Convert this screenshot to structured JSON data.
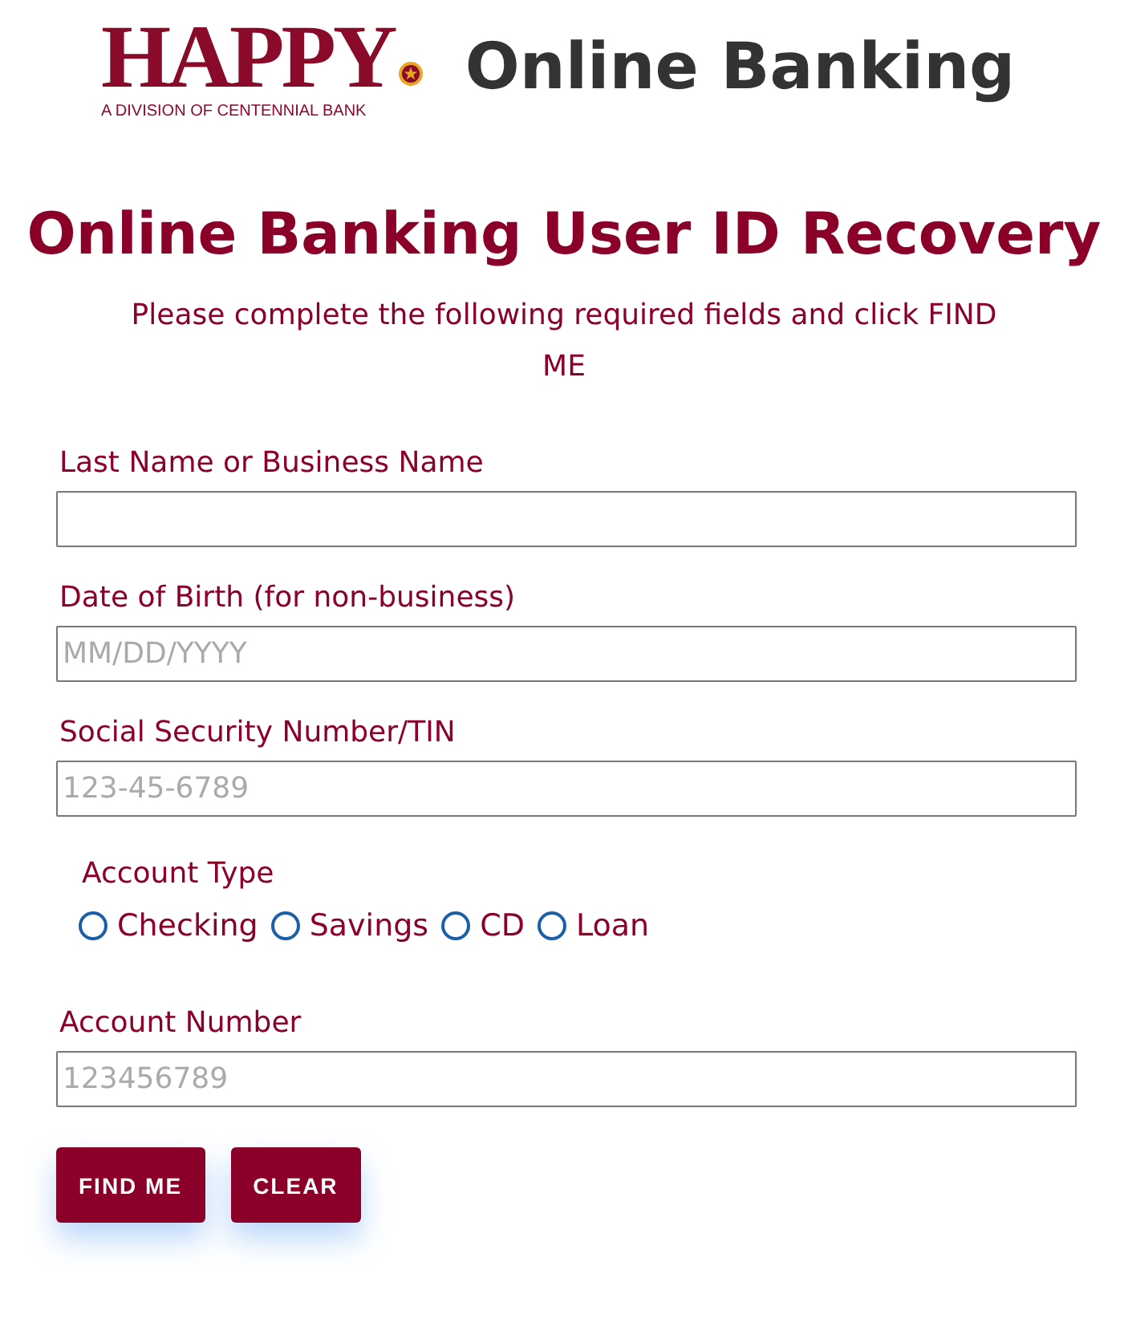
{
  "header": {
    "logo": {
      "wordmark": "HAPPY",
      "tagline": "A DIVISION OF CENTENNIAL BANK"
    },
    "title": "Online Banking"
  },
  "page_title": "Online Banking User ID Recovery",
  "instructions": "Please complete the following required fields and click FIND ME",
  "fields": [
    {
      "label": "Last Name or Business Name"
    },
    {
      "label": "Date of Birth (for non-business)",
      "placeholder": "MM/DD/YYYY"
    },
    {
      "label": "Social Security Number/TIN",
      "placeholder": "123-45-6789"
    }
  ],
  "account_type": {
    "label": "Account Type",
    "options": [
      {
        "label": "Checking",
        "selected": false
      },
      {
        "label": "Savings",
        "selected": false
      },
      {
        "label": "CD",
        "selected": false
      },
      {
        "label": "Loan",
        "selected": false
      }
    ]
  },
  "account_number": {
    "label": "Account Number",
    "placeholder": "123456789"
  },
  "buttons": [
    "FIND ME",
    "CLEAR"
  ]
}
